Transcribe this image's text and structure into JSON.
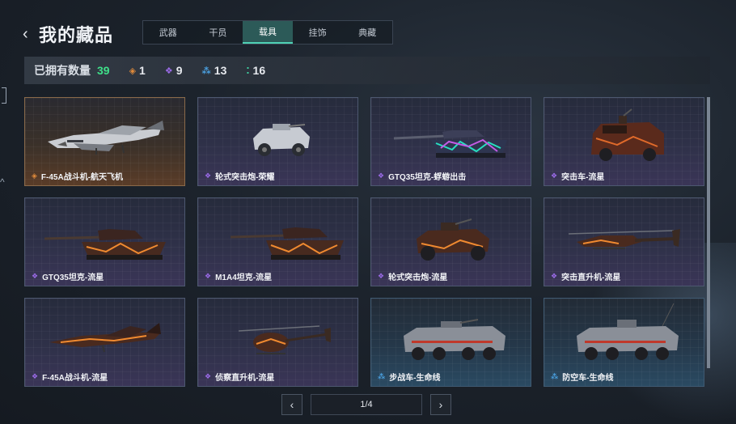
{
  "header": {
    "back_glyph": "‹",
    "title": "我的藏品"
  },
  "tabs": [
    {
      "label": "武器",
      "active": false
    },
    {
      "label": "干员",
      "active": false
    },
    {
      "label": "载具",
      "active": true
    },
    {
      "label": "挂饰",
      "active": false
    },
    {
      "label": "典藏",
      "active": false
    }
  ],
  "counts": {
    "label": "已拥有数量",
    "total": "39",
    "gold": "1",
    "purple": "9",
    "blue": "13",
    "green": "16"
  },
  "rarity_colors": {
    "gold": "#e08a3a",
    "purple": "#9b6be8",
    "blue": "#4aa0e0",
    "green": "#3fd0a0",
    "total": "#3fe08a"
  },
  "items": [
    {
      "name": "F-45A战斗机-航天飞机",
      "rarity": "gold",
      "icon": "fighter-jet-icon"
    },
    {
      "name": "轮式突击炮-荣耀",
      "rarity": "purple",
      "icon": "wheeled-assault-gun-icon"
    },
    {
      "name": "GTQ35坦克-蜉蝣出击",
      "rarity": "purple",
      "icon": "tank-icon"
    },
    {
      "name": "突击车-流星",
      "rarity": "purple",
      "icon": "assault-vehicle-icon"
    },
    {
      "name": "GTQ35坦克-流星",
      "rarity": "purple",
      "icon": "tank-icon"
    },
    {
      "name": "M1A4坦克-流星",
      "rarity": "purple",
      "icon": "tank-icon"
    },
    {
      "name": "轮式突击炮-流星",
      "rarity": "purple",
      "icon": "wheeled-assault-gun-icon"
    },
    {
      "name": "突击直升机-流星",
      "rarity": "purple",
      "icon": "attack-helicopter-icon"
    },
    {
      "name": "F-45A战斗机-流星",
      "rarity": "purple",
      "icon": "fighter-jet-icon"
    },
    {
      "name": "侦察直升机-流星",
      "rarity": "purple",
      "icon": "scout-helicopter-icon"
    },
    {
      "name": "步战车-生命线",
      "rarity": "blue",
      "icon": "infantry-fighting-vehicle-icon"
    },
    {
      "name": "防空车-生命线",
      "rarity": "blue",
      "icon": "anti-air-vehicle-icon"
    }
  ],
  "pager": {
    "prev": "‹",
    "page": "1/4",
    "next": "›"
  }
}
